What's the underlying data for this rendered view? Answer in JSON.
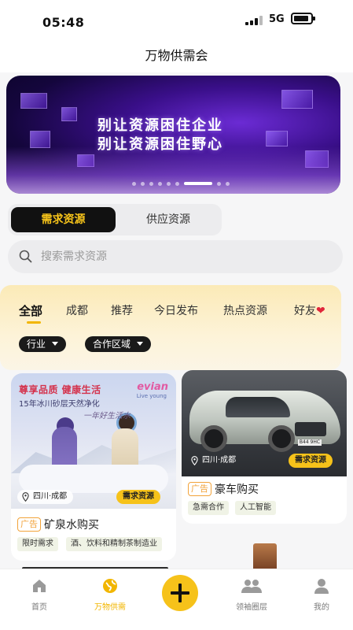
{
  "status": {
    "time": "05:48",
    "network": "5G"
  },
  "header": {
    "title": "万物供需会"
  },
  "banner": {
    "line1": "别让资源困住企业",
    "line2": "别让资源困住野心"
  },
  "resource_tabs": {
    "demand": "需求资源",
    "supply": "供应资源"
  },
  "search": {
    "placeholder": "搜索需求资源"
  },
  "categories": [
    {
      "label": "全部"
    },
    {
      "label": "成都"
    },
    {
      "label": "推荐"
    },
    {
      "label": "今日发布"
    },
    {
      "label": "热点资源"
    },
    {
      "label": "好友"
    }
  ],
  "filters": {
    "industry": "行业",
    "region": "合作区域"
  },
  "cards": [
    {
      "image_headline": "尊享品质 健康生活",
      "image_sub": "15年冰川砂层天然净化",
      "image_script": "一年好生活水",
      "image_brand": "evian",
      "image_brand_sub": "Live young",
      "location": "四川·成都",
      "badge": "需求资源",
      "ad_tag": "广告",
      "title": "矿泉水购买",
      "chips": [
        "限时需求",
        "酒、饮料和精制茶制造业"
      ]
    },
    {
      "location": "四川·成都",
      "badge": "需求资源",
      "ad_tag": "广告",
      "title": "豪车购买",
      "plate": "B44 9HC",
      "chips": [
        "急需合作",
        "人工智能"
      ]
    }
  ],
  "tabbar": {
    "home": "首页",
    "market": "万物供需",
    "circle": "领袖圈层",
    "mine": "我的"
  },
  "colors": {
    "accent": "#f6c21a",
    "ad": "#f2a33a",
    "heart": "#e0263a"
  }
}
